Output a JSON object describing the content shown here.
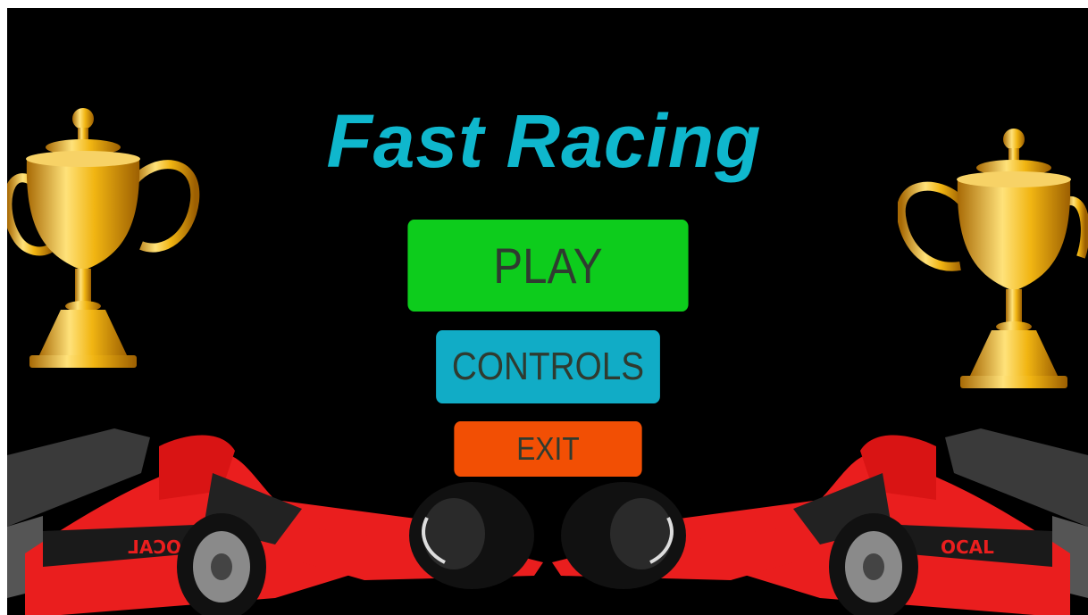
{
  "title": "Fast Racing",
  "menu": {
    "play_label": "PLAY",
    "controls_label": "CONTROLS",
    "exit_label": "EXIT"
  },
  "car_livery_text": "OCAL",
  "colors": {
    "background": "#000000",
    "title": "#0fb7cd",
    "play": "#0dcc1c",
    "controls": "#11acc6",
    "exit": "#f24f04",
    "button_text": "#2f3b30",
    "car_body": "#ea1e1e",
    "trophy_gold": "#f1b512"
  },
  "icons": [
    "trophy-icon",
    "race-car-icon"
  ]
}
